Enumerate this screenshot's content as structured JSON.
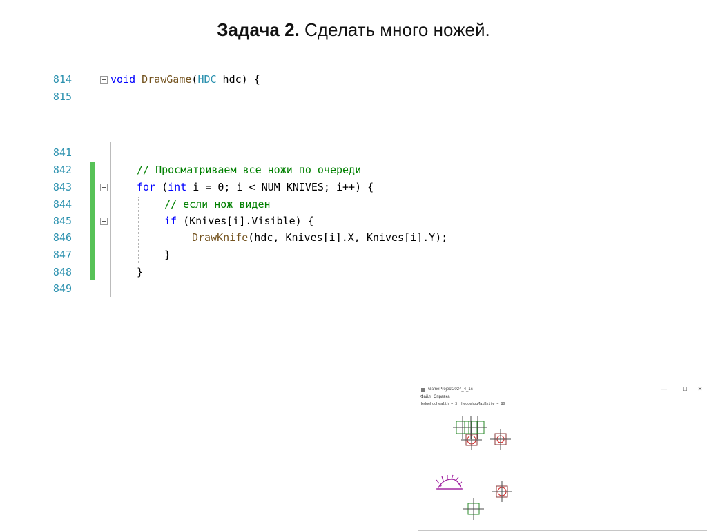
{
  "slide": {
    "title_bold": "Задача 2.",
    "title_rest": " Сделать много ножей."
  },
  "code": {
    "lines": [
      {
        "num": "814",
        "parts": [
          {
            "t": "void",
            "c": "kw"
          },
          {
            "t": " ",
            "c": "pl"
          },
          {
            "t": "DrawGame",
            "c": "fn"
          },
          {
            "t": "(",
            "c": "pl"
          },
          {
            "t": "HDC",
            "c": "ty"
          },
          {
            "t": " hdc) {",
            "c": "pl"
          }
        ]
      },
      {
        "num": "815",
        "parts": []
      },
      {
        "num": "841",
        "parts": []
      },
      {
        "num": "842",
        "parts": [
          {
            "t": "// Просматриваем все ножи по очереди",
            "c": "cm"
          }
        ]
      },
      {
        "num": "843",
        "parts": [
          {
            "t": "for",
            "c": "kw"
          },
          {
            "t": " (",
            "c": "pl"
          },
          {
            "t": "int",
            "c": "kw"
          },
          {
            "t": " i = 0; i < NUM_KNIVES; i++) {",
            "c": "pl"
          }
        ]
      },
      {
        "num": "844",
        "parts": [
          {
            "t": "// если нож виден",
            "c": "cm"
          }
        ]
      },
      {
        "num": "845",
        "parts": [
          {
            "t": "if",
            "c": "kw"
          },
          {
            "t": " (Knives[i].Visible) {",
            "c": "pl"
          }
        ]
      },
      {
        "num": "846",
        "parts": [
          {
            "t": "DrawKnife",
            "c": "fn"
          },
          {
            "t": "(hdc, Knives[i].X, Knives[i].Y);",
            "c": "pl"
          }
        ]
      },
      {
        "num": "847",
        "parts": [
          {
            "t": "}",
            "c": "pl"
          }
        ]
      },
      {
        "num": "848",
        "parts": [
          {
            "t": "}",
            "c": "pl"
          }
        ]
      },
      {
        "num": "849",
        "parts": []
      }
    ]
  },
  "window": {
    "title": "GameProject2024_4_1c",
    "minimize": "—",
    "maximize": "☐",
    "close": "✕",
    "menu": [
      "Файл",
      "Справка"
    ],
    "status": "HedgehogHealth = 3, HedgehogMaxKnife = 80",
    "colors": {
      "grid": "#4a4a4a",
      "knife_box": "#8b3a3a",
      "knife_circle": "#d02020",
      "hedgehog": "#a020a0",
      "green_box": "#2a8a2a"
    }
  }
}
